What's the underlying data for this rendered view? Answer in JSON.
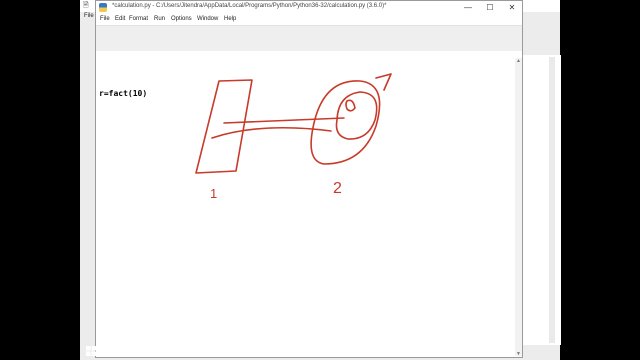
{
  "background_window": {
    "title_glyph": "🗎",
    "menu_file": "File",
    "close_glyph": "✕"
  },
  "window": {
    "title": "*calculation.py - C:/Users/Jitendra/AppData/Local/Programs/Python/Python36-32/calculation.py (3.6.0)*",
    "minimize_glyph": "—",
    "maximize_glyph": "☐",
    "close_glyph": "✕"
  },
  "menu": {
    "file": "File",
    "edit": "Edit",
    "format": "Format",
    "run": "Run",
    "options": "Options",
    "window": "Window",
    "help": "Help"
  },
  "editor": {
    "line1": "r=fact(10)"
  },
  "annotation": {
    "label_left": "1",
    "label_right": "2",
    "stroke_color": "#c83a2a"
  },
  "colors": {
    "desktop": "#000000",
    "window_bg": "#ffffff",
    "chrome_bg": "#f0f0f0"
  },
  "icons": {
    "start": "windows-logo-icon",
    "scroll_up": "chevron-up-icon",
    "scroll_down": "chevron-down-icon"
  }
}
